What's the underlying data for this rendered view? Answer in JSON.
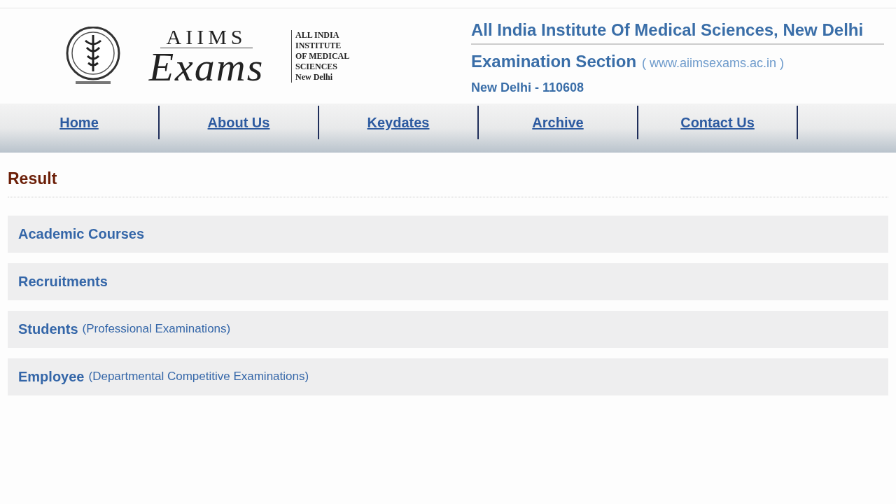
{
  "logo": {
    "top": "AIIMS",
    "script": "Exams",
    "side": [
      "ALL INDIA",
      "INSTITUTE",
      "OF MEDICAL",
      "SCIENCES",
      "New Delhi"
    ]
  },
  "header": {
    "title": "All India Institute Of Medical Sciences, New Delhi",
    "section": "Examination Section",
    "website": "( www.aiimsexams.ac.in )",
    "address": "New Delhi - 110608"
  },
  "nav": [
    "Home",
    "About Us",
    "Keydates",
    "Archive",
    "Contact Us"
  ],
  "page_title": "Result",
  "sections": [
    {
      "title": "Academic Courses"
    },
    {
      "title": "Recruitments"
    },
    {
      "title": "Students",
      "note": "(Professional Examinations)"
    },
    {
      "title": "Employee",
      "note": "(Departmental Competitive Examinations)"
    }
  ]
}
